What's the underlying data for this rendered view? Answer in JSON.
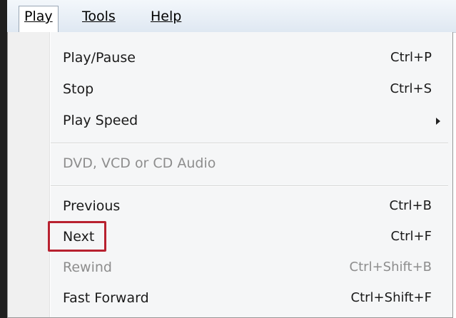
{
  "menubar": {
    "items": [
      {
        "label": "Play"
      },
      {
        "label": "Tools"
      },
      {
        "label": "Help"
      }
    ]
  },
  "play_menu": {
    "items": [
      {
        "label": "Play/Pause",
        "shortcut": "Ctrl+P"
      },
      {
        "label": "Stop",
        "shortcut": "Ctrl+S"
      },
      {
        "label": "Play Speed",
        "submenu": true
      },
      {
        "label": "DVD, VCD or CD Audio",
        "disabled": true
      },
      {
        "label": "Previous",
        "shortcut": "Ctrl+B"
      },
      {
        "label": "Next",
        "shortcut": "Ctrl+F"
      },
      {
        "label": "Rewind",
        "shortcut": "Ctrl+Shift+B",
        "disabled": true
      },
      {
        "label": "Fast Forward",
        "shortcut": "Ctrl+Shift+F"
      }
    ]
  },
  "annotation": {
    "highlight_color": "#b82230",
    "highlighted_item": "Next"
  }
}
